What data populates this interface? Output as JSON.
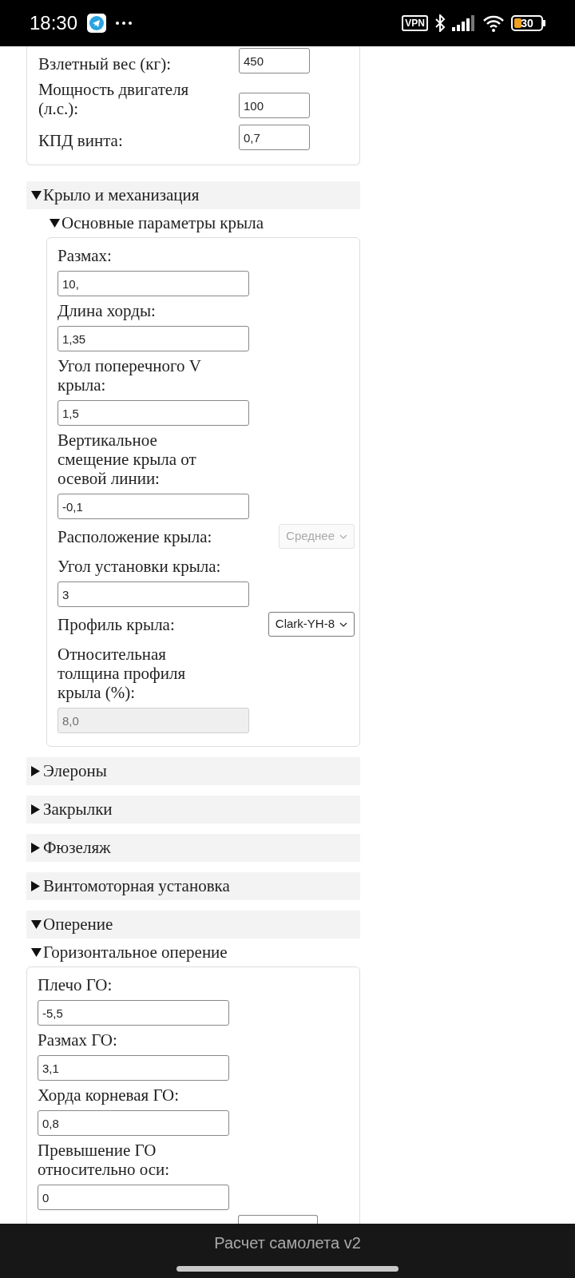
{
  "status_bar": {
    "time": "18:30",
    "vpn": "VPN",
    "battery": "30"
  },
  "top_fields": [
    {
      "label": "Взлетный вес (кг):",
      "value": "450"
    },
    {
      "label": "Мощность двигателя (л.с.):",
      "value": "100"
    },
    {
      "label": "КПД винта:",
      "value": "0,7"
    }
  ],
  "sections": [
    {
      "title": "Крыло и механизация",
      "expanded": true,
      "subsections": [
        {
          "title": "Основные параметры крыла",
          "expanded": true,
          "fields": [
            {
              "kind": "input",
              "label": "Размах:",
              "value": "10,"
            },
            {
              "kind": "input",
              "label": "Длина хорды:",
              "value": "1,35"
            },
            {
              "kind": "input",
              "label": "Угол поперечного V крыла:",
              "value": "1,5"
            },
            {
              "kind": "input",
              "label": "Вертикальное смещение крыла от осевой линии:",
              "value": "-0,1"
            },
            {
              "kind": "select",
              "label": "Расположение крыла:",
              "value": "Среднее",
              "disabled": true
            },
            {
              "kind": "input",
              "label": "Угол установки крыла:",
              "value": "3"
            },
            {
              "kind": "select",
              "label": "Профиль крыла:",
              "value": "Clark-YH-8",
              "disabled": false
            },
            {
              "kind": "readonly",
              "label": "Относительная толщина профиля крыла (%):",
              "value": "8,0"
            }
          ]
        }
      ]
    },
    {
      "title": "Элероны",
      "expanded": false
    },
    {
      "title": "Закрылки",
      "expanded": false
    },
    {
      "title": "Фюзеляж",
      "expanded": false
    },
    {
      "title": "Винтомоторная установка",
      "expanded": false
    },
    {
      "title": "Оперение",
      "expanded": true,
      "subsections": [
        {
          "title": "Горизонтальное оперение",
          "expanded": true,
          "fields": [
            {
              "kind": "input",
              "label": "Плечо ГО:",
              "value": "-5,5"
            },
            {
              "kind": "input",
              "label": "Размах ГО:",
              "value": "3,1"
            },
            {
              "kind": "input",
              "label": "Хорда корневая ГО:",
              "value": "0,8"
            },
            {
              "kind": "input",
              "label": "Превышение ГО относительно оси:",
              "value": "0"
            },
            {
              "kind": "cut-input"
            }
          ]
        }
      ]
    }
  ],
  "app_title": "Расчет самолета v2"
}
